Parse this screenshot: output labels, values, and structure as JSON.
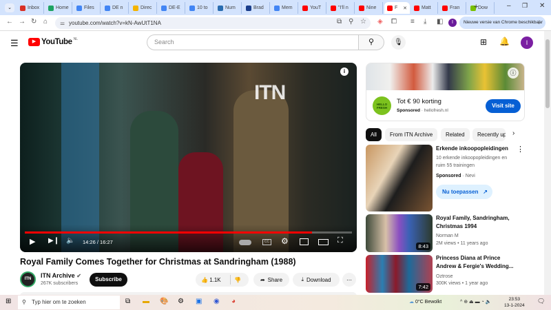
{
  "browser": {
    "tabs": [
      {
        "label": "Inbox",
        "color": "#d93025"
      },
      {
        "label": "Home",
        "color": "#1ea362"
      },
      {
        "label": "Files",
        "color": "#4285f4"
      },
      {
        "label": "DE n",
        "color": "#4285f4"
      },
      {
        "label": "Direc",
        "color": "#f4b400"
      },
      {
        "label": "DE-E",
        "color": "#4285f4"
      },
      {
        "label": "10 to",
        "color": "#4285f4"
      },
      {
        "label": "Num",
        "color": "#2a6db0"
      },
      {
        "label": "Brad",
        "color": "#1a3e8c"
      },
      {
        "label": "Mem",
        "color": "#4285f4"
      },
      {
        "label": "YouT",
        "color": "#ff0000"
      },
      {
        "label": "\"I'll n",
        "color": "#ff0000"
      },
      {
        "label": "Nine",
        "color": "#ff0000"
      },
      {
        "label": "F",
        "color": "#ff0000",
        "active": true
      },
      {
        "label": "Matt",
        "color": "#ff0000"
      },
      {
        "label": "Fran",
        "color": "#ff0000"
      },
      {
        "label": "Dow",
        "color": "#78c000"
      }
    ],
    "url": "youtube.com/watch?v=kN-AwUtT1NA",
    "update_label": "Nieuwe versie van Chrome beschikbaar",
    "profile_initial": "I"
  },
  "youtube": {
    "logo": "YouTube",
    "region": "NL",
    "search_placeholder": "Search",
    "avatar_initial": "I",
    "player": {
      "watermark": "ITN",
      "time": "14:26 / 16:27",
      "progress": 0.877
    },
    "video_title": "Royal Family Comes Together for Christmas at Sandringham (1988)",
    "channel": {
      "name": "ITN Archive",
      "subscribers": "267K subscribers",
      "avatar_text": "ITN"
    },
    "subscribe_label": "Subscribe",
    "likes": "1.1K",
    "share_label": "Share",
    "download_label": "Download",
    "ad": {
      "title": "Tot € 90 korting",
      "sponsored": "Sponsored",
      "domain": "hellofresh.nl",
      "logo_text": "HELLO FRESH",
      "cta": "Visit site"
    },
    "chips": [
      "All",
      "From ITN Archive",
      "Related",
      "Recently up"
    ],
    "ad2": {
      "title": "Erkende inkoopopleidingen",
      "desc": "10 erkende inkoopopleidingen en ruim 55 trainingen",
      "sponsored": "Sponsored",
      "advertiser": "Nevi",
      "cta": "Nu toepassen"
    },
    "recs": [
      {
        "title": "Royal Family, Sandringham, Christmas 1994",
        "channel": "Norman M",
        "meta": "2M views • 11 years ago",
        "duration": "8:43"
      },
      {
        "title": "Princess Diana at Prince Andrew & Fergie's Wedding...",
        "channel": "Oztrose",
        "meta": "300K views • 1 year ago",
        "duration": "7:42"
      }
    ]
  },
  "taskbar": {
    "search_placeholder": "Typ hier om te zoeken",
    "weather": "0°C  Bewolkt",
    "time": "23:53",
    "date": "13-1-2024"
  }
}
